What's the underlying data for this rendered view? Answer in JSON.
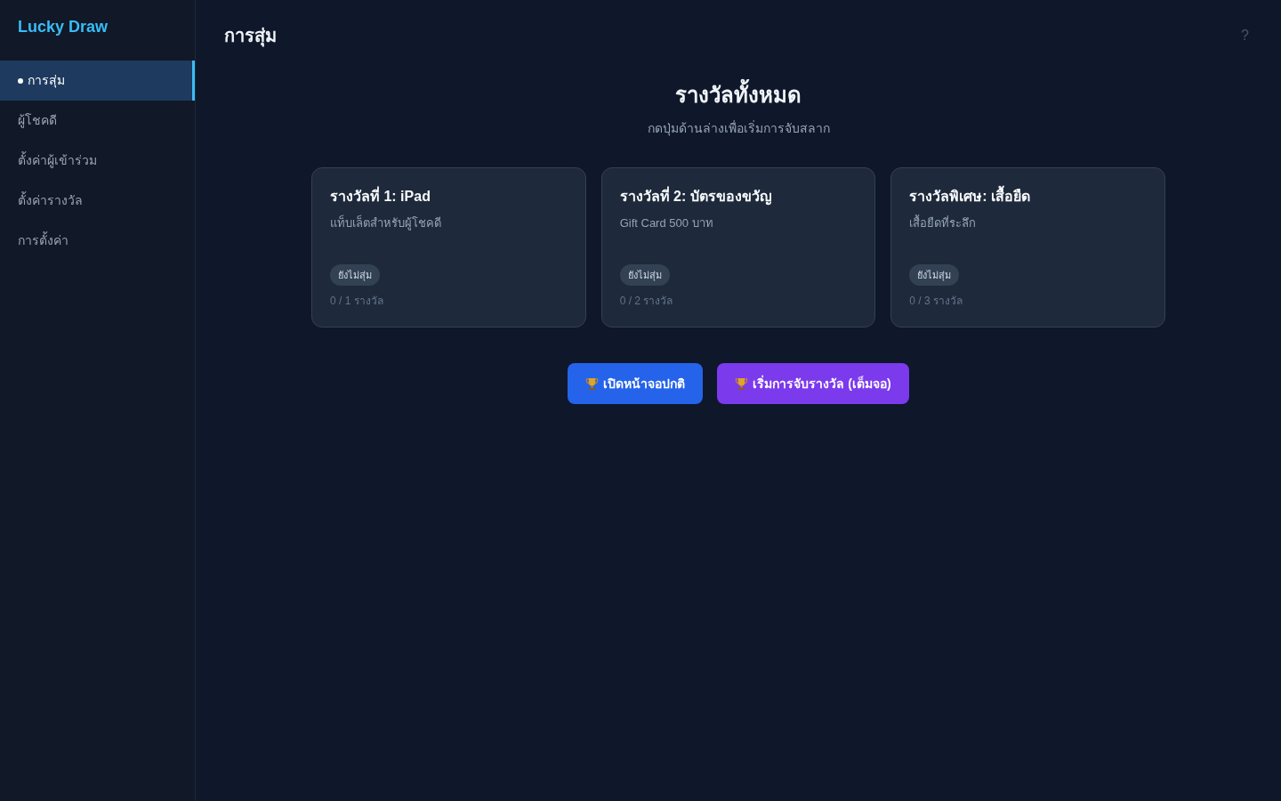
{
  "sidebar": {
    "brand": "Lucky Draw",
    "items": [
      {
        "label": "การสุ่ม",
        "selected": true
      },
      {
        "label": "ผู้โชคดี",
        "selected": false
      },
      {
        "label": "ตั้งค่าผู้เข้าร่วม",
        "selected": false
      },
      {
        "label": "ตั้งค่ารางวัล",
        "selected": false
      },
      {
        "label": "การตั้งค่า",
        "selected": false
      }
    ]
  },
  "header": {
    "title": "การสุ่ม",
    "help": "?"
  },
  "prizes_section": {
    "title": "รางวัลทั้งหมด",
    "subtitle": "กดปุ่มด้านล่างเพื่อเริ่มการจับสลาก",
    "prizes": [
      {
        "title": "รางวัลที่ 1: iPad",
        "description": "แท็บเล็ตสำหรับผู้โชคดี",
        "status": "ยังไม่สุ่ม",
        "count": "0 / 1 รางวัล"
      },
      {
        "title": "รางวัลที่ 2: บัตรของขวัญ",
        "description": "Gift Card 500 บาท",
        "status": "ยังไม่สุ่ม",
        "count": "0 / 2 รางวัล"
      },
      {
        "title": "รางวัลพิเศษ: เสื้อยืด",
        "description": "เสื้อยืดที่ระลึก",
        "status": "ยังไม่สุ่ม",
        "count": "0 / 3 รางวัล"
      }
    ]
  },
  "actions": [
    {
      "label": "เปิดหน้าจอปกติ",
      "kind": "primary"
    },
    {
      "label": "เริ่มการจับรางวัล (เต็มจอ)",
      "kind": "fullscreen"
    }
  ]
}
